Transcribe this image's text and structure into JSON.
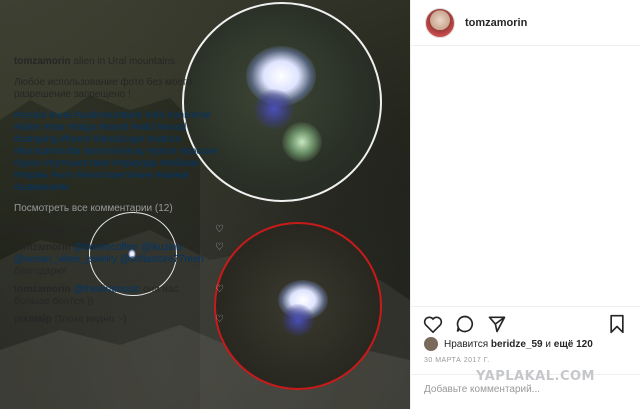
{
  "post": {
    "username": "tomzamorin",
    "caption_text": "alien in Ural mountains",
    "notice": "Любое использование фото без моего разрешение запрещено !",
    "hashtags": "#russia #ural #uralmountains #ufo #universe #alien #star #taiga #travel #wild #wood #camping #forest #landscape #nature #konicaminolta #permskykray #perm #россия #урал #путешествия #природа #пейзаж #пермь #нло #инопланетянин #мэнкв #шаманизм",
    "view_all": "Посмотреть все комментарии (12)"
  },
  "comments": [
    {
      "user": "avedesign",
      "text": "Класс!"
    },
    {
      "user": "tomzamorin",
      "mentions": "@benitocoffee @lkuzina @ocean_vibes_jewelry @sofiastore77men",
      "text": "благодарю!"
    },
    {
      "user": "tomzamorin",
      "mentions": "@theairamusic",
      "text": "они нас больше боятся ))"
    },
    {
      "user": "pixmaip",
      "text": "Плохо видно :-)"
    }
  ],
  "likes": {
    "prefix": "Нравится",
    "user": "beridze_59",
    "suffix": "и",
    "more": "ещё 120"
  },
  "date": "30 МАРТА 2017 Г.",
  "add_comment_placeholder": "Добавьте комментарий...",
  "watermark": "YAPLAKAL.COM",
  "icons": [
    "heart-icon",
    "comment-icon",
    "share-icon",
    "bookmark-icon"
  ]
}
